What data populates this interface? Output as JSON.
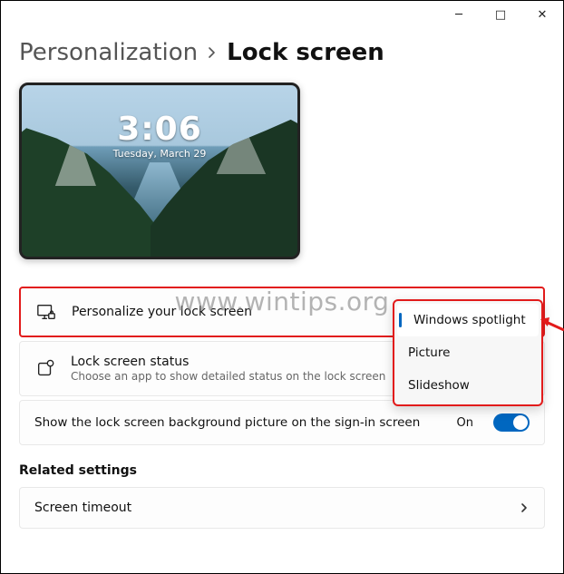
{
  "window": {
    "minimize": "─",
    "maximize": "□",
    "close": "✕"
  },
  "breadcrumb": {
    "parent": "Personalization",
    "current": "Lock screen"
  },
  "preview": {
    "time": "3:06",
    "date": "Tuesday, March 29"
  },
  "watermark": "www.wintips.org",
  "rows": {
    "personalize": {
      "title": "Personalize your lock screen"
    },
    "status": {
      "title": "Lock screen status",
      "sub": "Choose an app to show detailed status on the lock screen"
    },
    "signin_bg": {
      "title": "Show the lock screen background picture on the sign-in screen",
      "state": "On"
    }
  },
  "dropdown": {
    "opt1": "Windows spotlight",
    "opt2": "Picture",
    "opt3": "Slideshow"
  },
  "related": {
    "heading": "Related settings",
    "screen_timeout": "Screen timeout"
  }
}
